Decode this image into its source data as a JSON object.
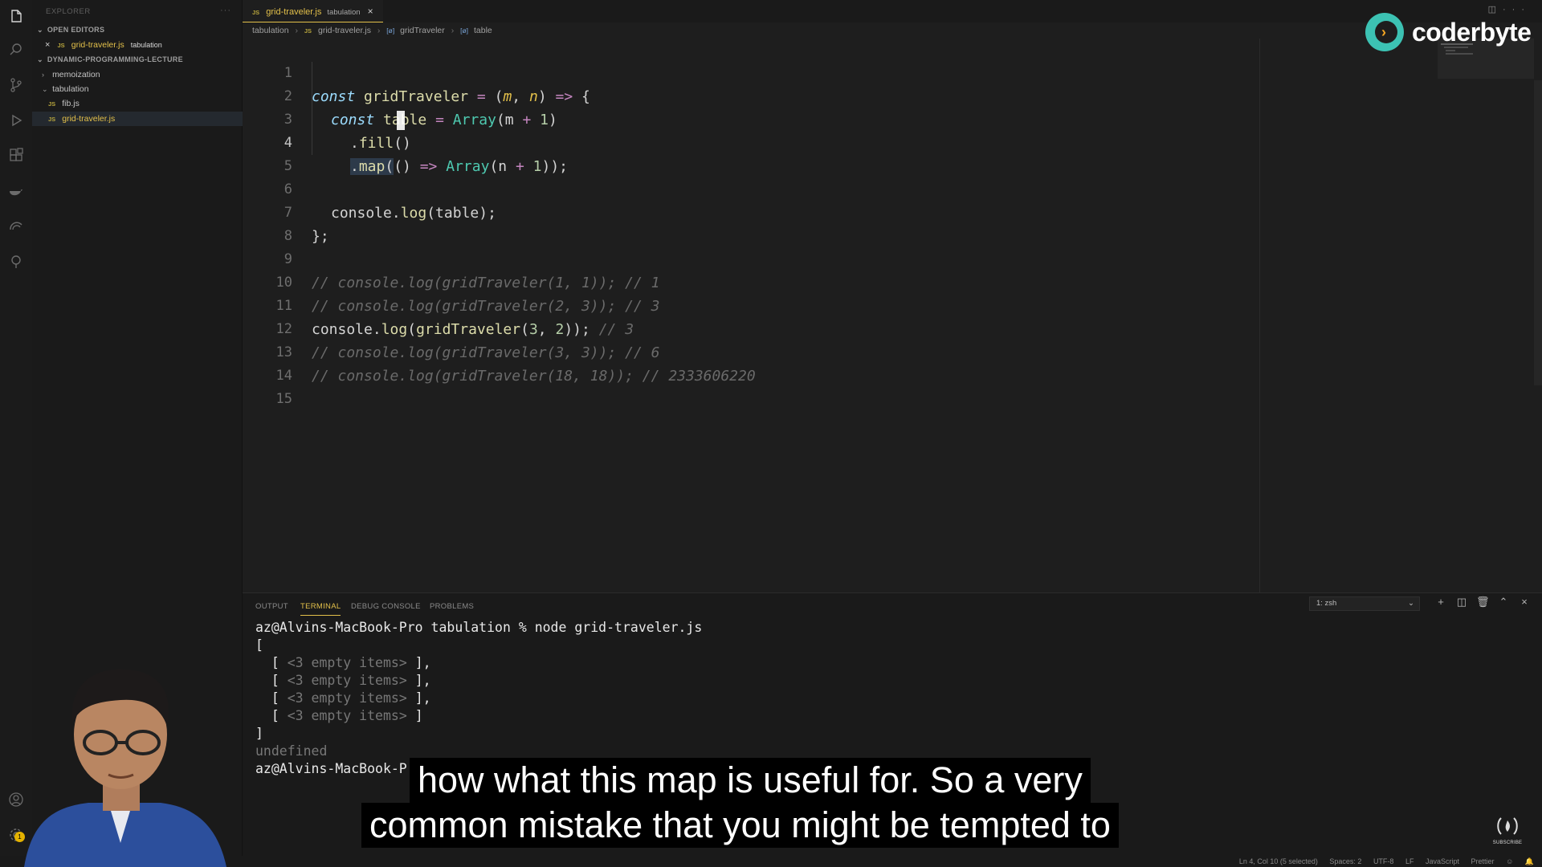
{
  "sidebar": {
    "title": "EXPLORER",
    "more": "···",
    "open_editors_label": "OPEN EDITORS",
    "open_editor": {
      "file": "grid-traveler.js",
      "folder": "tabulation"
    },
    "project_label": "DYNAMIC-PROGRAMMING-LECTURE",
    "folders": [
      {
        "name": "memoization"
      },
      {
        "name": "tabulation"
      }
    ],
    "files": [
      {
        "name": "fib.js"
      },
      {
        "name": "grid-traveler.js"
      }
    ],
    "js_badge": "JS"
  },
  "tab": {
    "name": "grid-traveler.js",
    "desc": "tabulation",
    "close": "×"
  },
  "breadcrumb": {
    "items": [
      "tabulation",
      "grid-traveler.js",
      "gridTraveler",
      "table"
    ],
    "sep": "›",
    "sym": "[ø]"
  },
  "editor": {
    "line_numbers": [
      "1",
      "2",
      "3",
      "4",
      "5",
      "6",
      "7",
      "8",
      "9",
      "10",
      "11",
      "12",
      "13",
      "14",
      "15"
    ],
    "comments": {
      "l9": "// console.log(gridTraveler(1, 1)); // 1",
      "l10": "// console.log(gridTraveler(2, 3)); // 3",
      "l11": "// 3",
      "l12": "// console.log(gridTraveler(3, 3)); // 6",
      "l13": "// console.log(gridTraveler(18, 18)); // 2333606220"
    }
  },
  "logo": {
    "text": "coderbyte"
  },
  "panel": {
    "tabs": [
      "OUTPUT",
      "TERMINAL",
      "DEBUG CONSOLE",
      "PROBLEMS"
    ],
    "active_tab": "TERMINAL",
    "terminal_select": "1: zsh",
    "terminal": {
      "prompt": "az@Alvins-MacBook-Pro tabulation % ",
      "command": "node grid-traveler.js",
      "open_bracket": "[",
      "row_open": "  [ ",
      "row_body": "<3 empty items>",
      "row_close_comma": " ],",
      "row_close": " ]",
      "close_bracket": "]",
      "undefined": "undefined",
      "prompt_partial": "az@Alvins-MacBook-P"
    }
  },
  "status": {
    "position": "Ln 4, Col 10 (5 selected)",
    "spaces": "Spaces: 2",
    "encoding": "UTF-8",
    "eol": "LF",
    "language": "JavaScript",
    "formatter": "Prettier"
  },
  "captions": {
    "line1": "how what this map is useful for. So a very",
    "line2": "common mistake that you might be tempted to"
  },
  "subscribe": {
    "label": "SUBSCRIBE"
  },
  "colors": {
    "accent": "#e3c04a",
    "logo_teal": "#3cc2b3",
    "background": "#1e1e1e"
  }
}
